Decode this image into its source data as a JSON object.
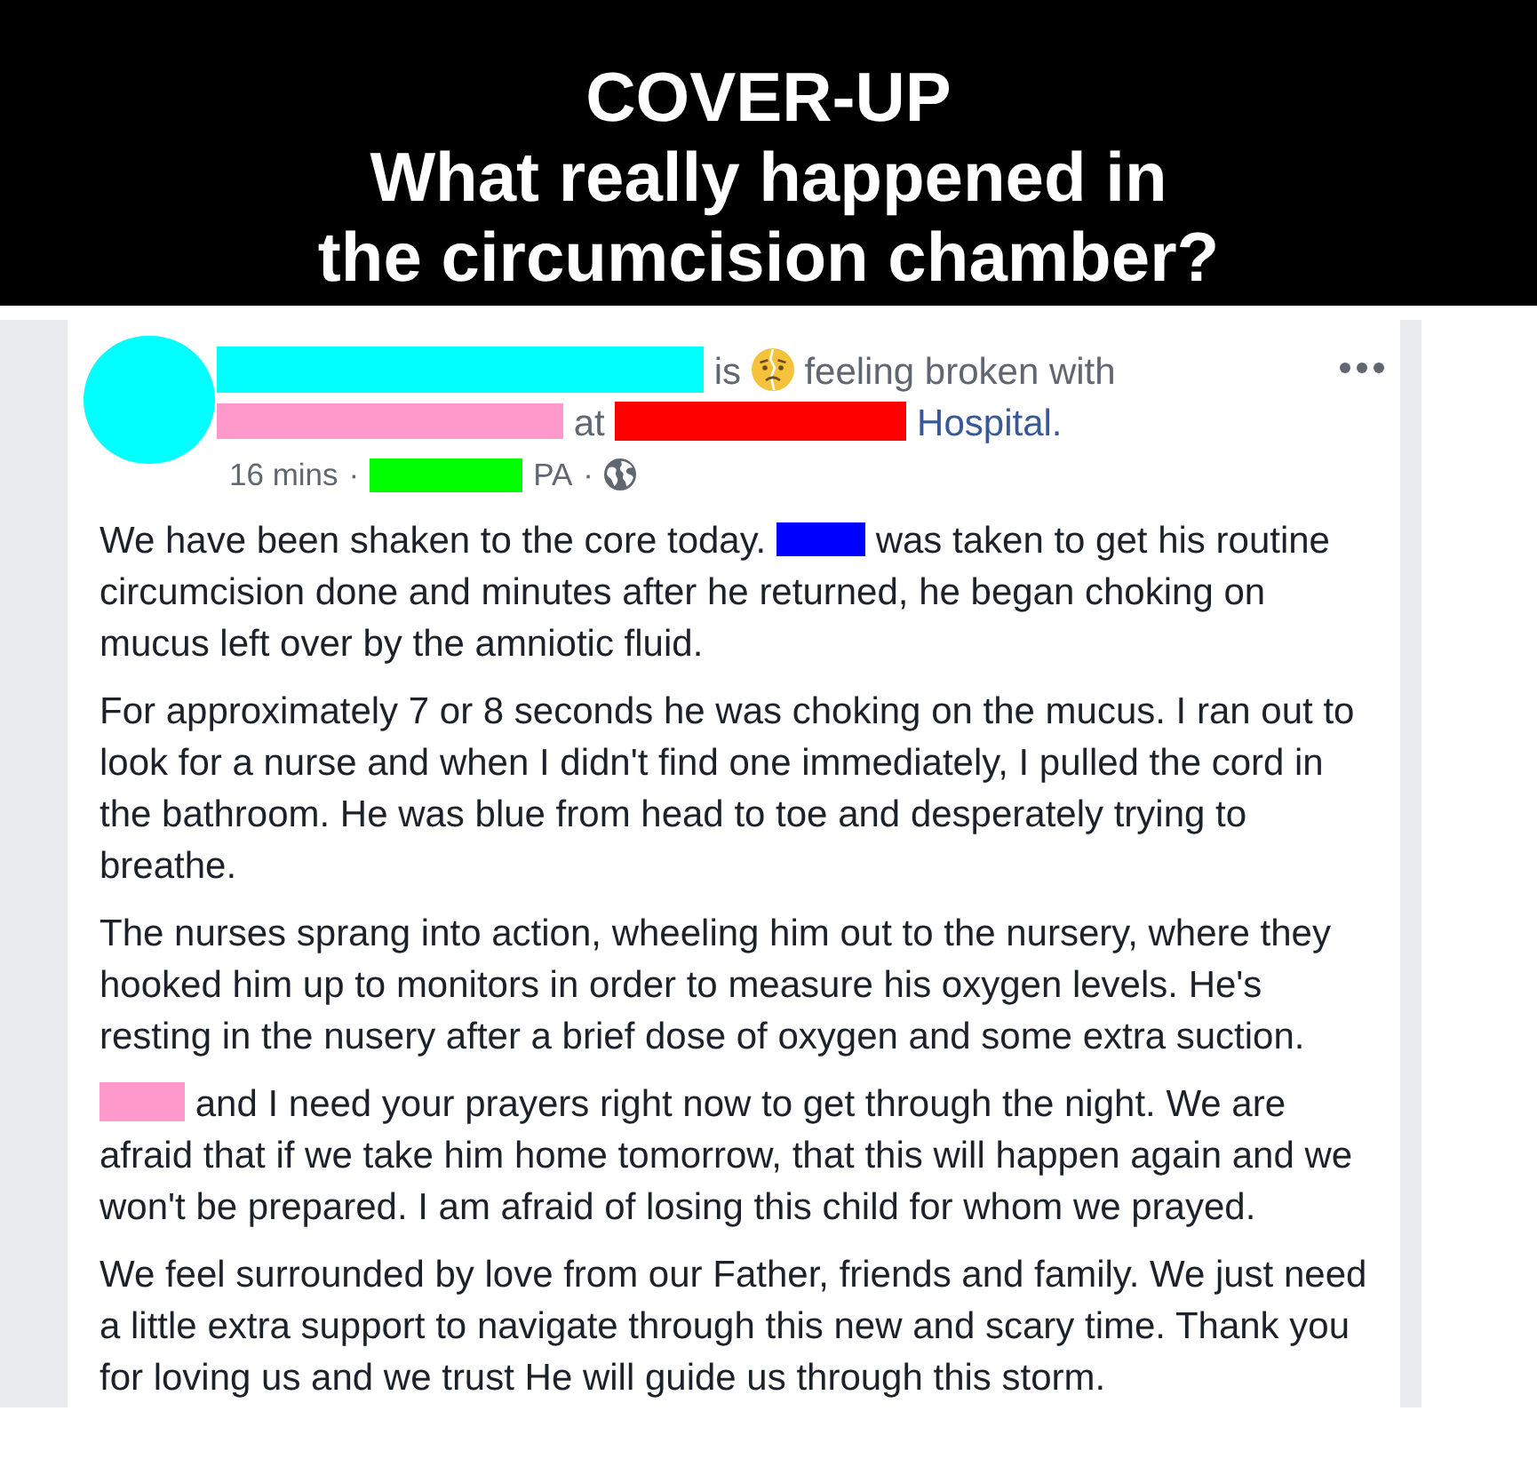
{
  "banner": {
    "title": "COVER-UP",
    "headline_lines": [
      "What really happened in",
      "the circumcision chamber?"
    ]
  },
  "post": {
    "avatar": {
      "color": "#00ffff"
    },
    "activity": [
      {
        "kind": "redaction",
        "color": "#00ffff"
      },
      {
        "kind": "text",
        "text": "is"
      },
      {
        "kind": "emoji"
      },
      {
        "kind": "text",
        "text": "feeling broken with"
      },
      {
        "kind": "redaction",
        "color": "#ff99cc"
      },
      {
        "kind": "text",
        "text": "at"
      },
      {
        "kind": "redaction",
        "color": "#ff0000"
      },
      {
        "kind": "link",
        "text": "Hospital."
      }
    ],
    "meta": [
      {
        "kind": "time",
        "text": "16 mins"
      },
      {
        "kind": "separator",
        "text": "·"
      },
      {
        "kind": "redaction",
        "color": "#00ff00"
      },
      {
        "kind": "text",
        "text": "PA"
      },
      {
        "kind": "separator",
        "text": "·"
      },
      {
        "kind": "globe"
      }
    ],
    "paragraphs": [
      [
        {
          "kind": "text",
          "text": "We have been shaken to the core today."
        },
        {
          "kind": "redaction",
          "color": "#0000ff"
        },
        {
          "kind": "text",
          "text": "was taken to get his routine circumcision done and minutes after he returned, he began choking on mucus left over by the amniotic fluid."
        }
      ],
      [
        {
          "kind": "text",
          "text": "For approximately 7 or 8 seconds he was choking on the mucus. I ran out to look for a nurse and when I didn't find one immediately, I pulled the cord in the bathroom. He was blue from head to toe and desperately trying to breathe."
        }
      ],
      [
        {
          "kind": "text",
          "text": "The nurses sprang into action, wheeling him out to the nursery, where they hooked him up to monitors in order to measure his oxygen levels. He's resting in the nusery after a brief dose of oxygen and some extra suction."
        }
      ],
      [
        {
          "kind": "redaction",
          "color": "#ff99cc"
        },
        {
          "kind": "text",
          "text": "and I need your prayers right now to get through the night. We are afraid that if we take him home tomorrow, that this will happen again and we won't be prepared. I am afraid of losing this child for whom we prayed."
        }
      ],
      [
        {
          "kind": "text",
          "text": "We feel surrounded by love from our Father, friends and family. We just need a little extra support to navigate through this new and scary time. Thank you for loving us and we trust He will guide us through this storm."
        }
      ]
    ]
  }
}
